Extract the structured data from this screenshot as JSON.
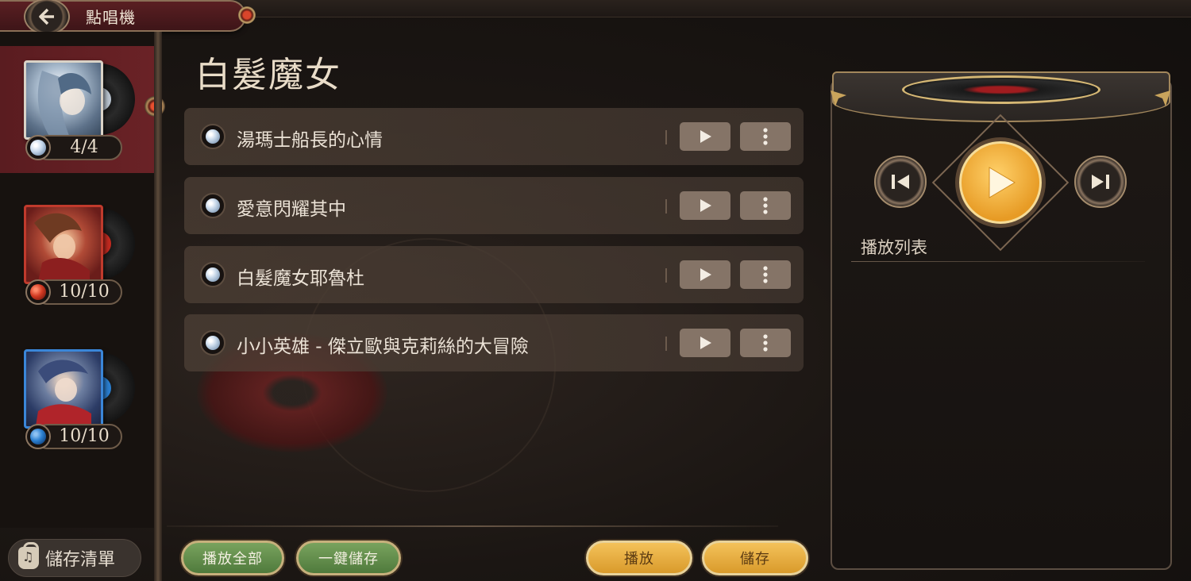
{
  "header": {
    "title": "點唱機"
  },
  "albums": [
    {
      "count": "4/4",
      "active": true,
      "badge_color": "#c4d6ea",
      "cover_color": "#8fa3b8"
    },
    {
      "count": "10/10",
      "active": false,
      "badge_color": "#d23a22",
      "cover_color": "#a8322c"
    },
    {
      "count": "10/10",
      "active": false,
      "badge_color": "#2b7fd0",
      "cover_color": "#3c6aa0"
    }
  ],
  "sidebar": {
    "save_list_label": "儲存清單"
  },
  "main": {
    "album_title": "白髮魔女",
    "songs": [
      {
        "name": "湯瑪士船長的心情"
      },
      {
        "name": "愛意閃耀其中"
      },
      {
        "name": "白髮魔女耶魯杜"
      },
      {
        "name": "小小英雄 - 傑立歐與克莉絲的大冒險"
      }
    ]
  },
  "footer": {
    "play_all": "播放全部",
    "one_click_save": "一鍵儲存",
    "play": "播放",
    "save": "儲存"
  },
  "player": {
    "playlist_label": "播放列表"
  },
  "colors": {
    "accent_gold": "#e9a63a",
    "accent_green": "#5f8a47",
    "active_red": "#5e1e22"
  }
}
